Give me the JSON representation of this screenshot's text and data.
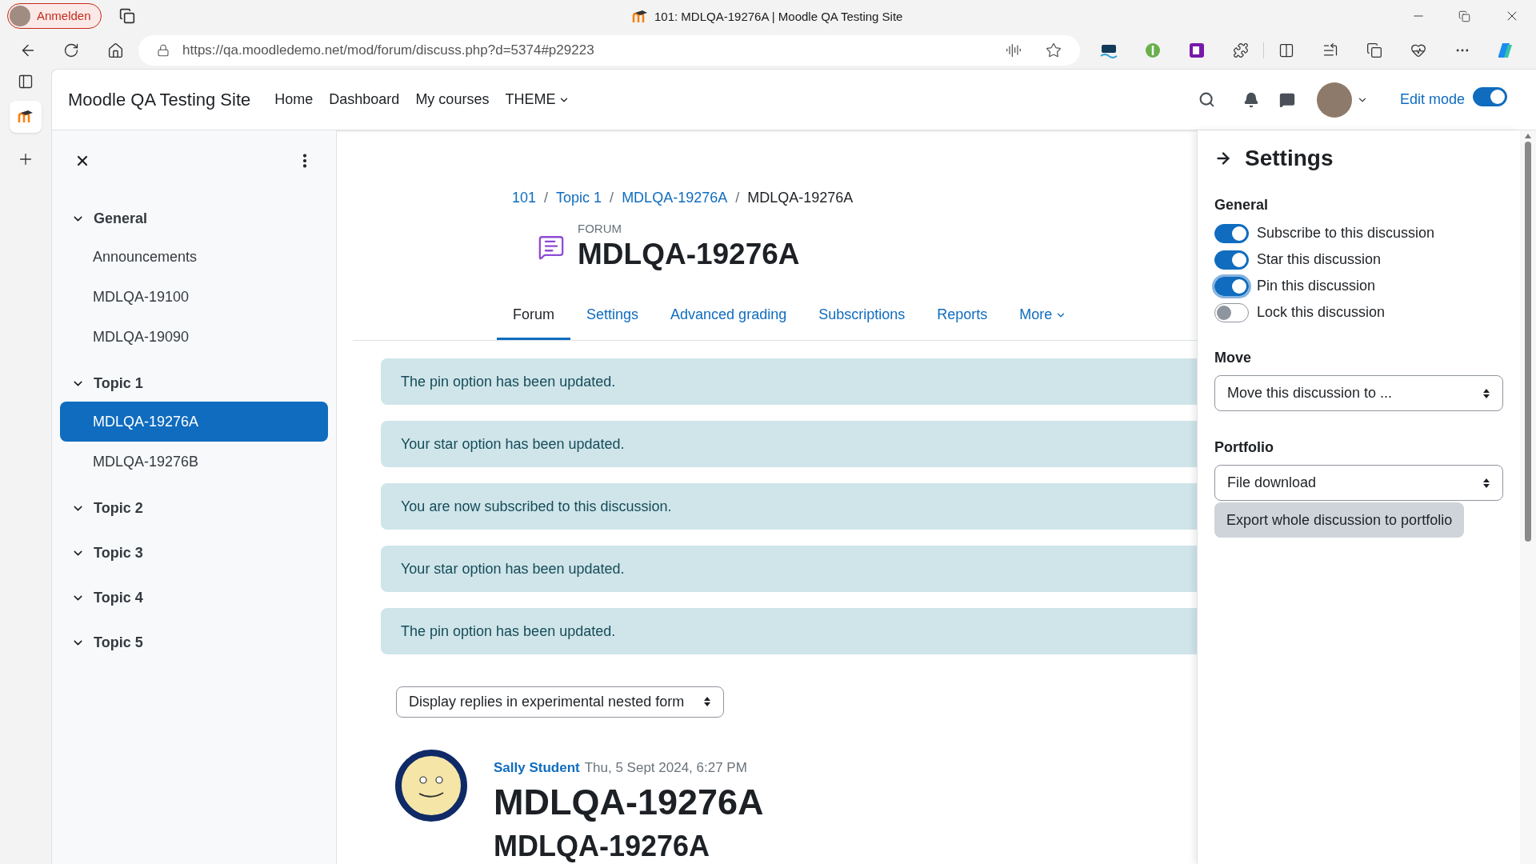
{
  "browser": {
    "profile_label": "Anmelden",
    "tab_title": "101: MDLQA-19276A | Moodle QA Testing Site",
    "url": "https://qa.moodledemo.net/mod/forum/discuss.php?d=5374#p29223"
  },
  "header": {
    "site_name": "Moodle QA Testing Site",
    "nav": [
      {
        "label": "Home",
        "kind": "link"
      },
      {
        "label": "Dashboard",
        "kind": "link"
      },
      {
        "label": "My courses",
        "kind": "link"
      },
      {
        "label": "THEME",
        "kind": "menu"
      }
    ],
    "edit_mode": {
      "label": "Edit mode",
      "on": true
    }
  },
  "drawer": {
    "sections": [
      {
        "title": "General",
        "expanded": true,
        "items": [
          {
            "label": "Announcements",
            "selected": false
          },
          {
            "label": "MDLQA-19100",
            "selected": false
          },
          {
            "label": "MDLQA-19090",
            "selected": false
          }
        ]
      },
      {
        "title": "Topic 1",
        "expanded": true,
        "items": [
          {
            "label": "MDLQA-19276A",
            "selected": true
          },
          {
            "label": "MDLQA-19276B",
            "selected": false
          }
        ]
      },
      {
        "title": "Topic 2",
        "expanded": true
      },
      {
        "title": "Topic 3",
        "expanded": true
      },
      {
        "title": "Topic 4",
        "expanded": true
      },
      {
        "title": "Topic 5",
        "expanded": true
      }
    ]
  },
  "breadcrumb": [
    {
      "label": "101",
      "link": true
    },
    {
      "separator": "/",
      "label": "Topic 1",
      "link": true
    },
    {
      "separator": "/",
      "label": "MDLQA-19276A",
      "link": true
    },
    {
      "separator": "/",
      "label": "MDLQA-19276A",
      "link": false
    }
  ],
  "forum": {
    "kicker": "FORUM",
    "title": "MDLQA-19276A"
  },
  "tabs": [
    {
      "label": "Forum",
      "selected": true,
      "kind": "link"
    },
    {
      "label": "Settings",
      "selected": false,
      "kind": "link"
    },
    {
      "label": "Advanced grading",
      "selected": false,
      "kind": "link"
    },
    {
      "label": "Subscriptions",
      "selected": false,
      "kind": "link"
    },
    {
      "label": "Reports",
      "selected": false,
      "kind": "link"
    },
    {
      "label": "More",
      "selected": false,
      "kind": "menu"
    }
  ],
  "alerts": [
    "The pin option has been updated.",
    "Your star option has been updated.",
    "You are now subscribed to this discussion.",
    "Your star option has been updated.",
    "The pin option has been updated."
  ],
  "display_select": {
    "value": "Display replies in experimental nested form"
  },
  "post": {
    "author": "Sally Student",
    "date": "Thu, 5 Sept 2024, 6:27 PM",
    "subject": "MDLQA-19276A",
    "heading": "MDLQA-19276A"
  },
  "settings": {
    "title": "Settings",
    "general_heading": "General",
    "toggles": [
      {
        "label": "Subscribe to this discussion",
        "on": true,
        "focused": false
      },
      {
        "label": "Star this discussion",
        "on": true,
        "focused": false
      },
      {
        "label": "Pin this discussion",
        "on": true,
        "focused": true
      },
      {
        "label": "Lock this discussion",
        "on": false,
        "focused": false
      }
    ],
    "move": {
      "heading": "Move",
      "value": "Move this discussion to ..."
    },
    "portfolio": {
      "heading": "Portfolio",
      "value": "File download",
      "button": "Export whole discussion to portfolio"
    }
  }
}
